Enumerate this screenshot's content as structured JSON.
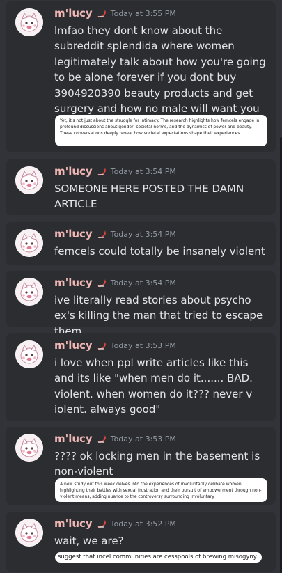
{
  "messages": [
    {
      "author": "m'lucy",
      "time": "Today at 3:55 PM",
      "text": "lmfao they dont know about the subreddit splendida where women legitimately talk about how you're going to be alone forever if you dont buy 3904920390 beauty products and get surgery and how no male will want you",
      "attachment": "Yet, it's not just about the struggle for intimacy. The research highlights how femcels engage in profound discussions about gender, societal norms, and the dynamics of power and beauty. These conversations deeply reveal how societal expectations shape their experiences."
    },
    {
      "author": "m'lucy",
      "time": "Today at 3:54 PM",
      "text": "SOMEONE HERE POSTED THE DAMN ARTICLE"
    },
    {
      "author": "m'lucy",
      "time": "Today at 3:54 PM",
      "text": "femcels could totally be insanely violent"
    },
    {
      "author": "m'lucy",
      "time": "Today at 3:54 PM",
      "text": "ive literally read stories about psycho ex's killing the man that tried to escape them"
    },
    {
      "author": "m'lucy",
      "time": "Today at 3:53 PM",
      "text": "i love when ppl write articles like this and its like \"when men do it....... BAD. violent. when women do it??? never v iolent. always good\""
    },
    {
      "author": "m'lucy",
      "time": "Today at 3:53 PM",
      "text": "???? ok locking men in the basement is non-violent",
      "attachment": "A new study out this week delves into the experiences of involuntarily celibate women, highlighting their battles with sexual frustration and their pursuit of empowerment through non-violent means, adding nuance to the controversy surrounding involuntary"
    },
    {
      "author": "m'lucy",
      "time": "Today at 3:52 PM",
      "text": "wait, we are?",
      "attachment": "suggest that incel communities are cesspools of brewing misogyny."
    }
  ]
}
